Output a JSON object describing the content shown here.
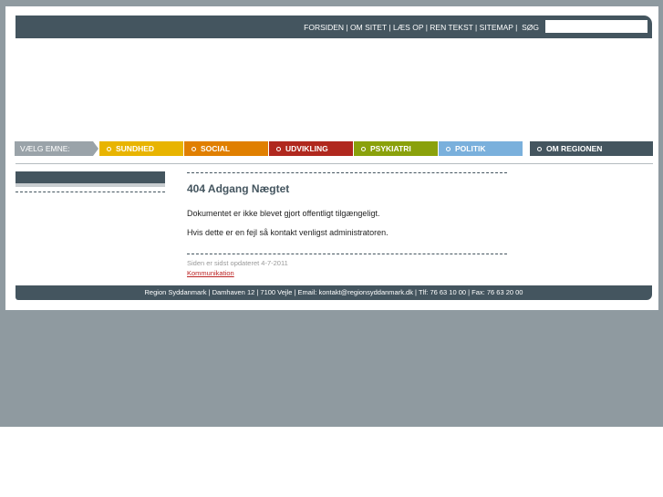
{
  "top_nav": {
    "links": [
      "FORSIDEN",
      "OM SITET",
      "LÆS OP",
      "REN TEKST",
      "SITEMAP"
    ],
    "search_label": "SØG",
    "search_value": ""
  },
  "topic_nav": {
    "label": "VÆLG EMNE:",
    "items": [
      {
        "label": "SUNDHED",
        "color": "#e8b400"
      },
      {
        "label": "SOCIAL",
        "color": "#e07f00"
      },
      {
        "label": "UDVIKLING",
        "color": "#b0281e"
      },
      {
        "label": "PSYKIATRI",
        "color": "#8aa10b"
      },
      {
        "label": "POLITIK",
        "color": "#7ab0dc"
      }
    ],
    "om": "OM REGIONEN"
  },
  "content": {
    "title": "404 Adgang Nægtet",
    "p1": "Dokumentet er ikke blevet gjort offentligt tilgængeligt.",
    "p2": "Hvis dette er en fejl så kontakt venligst administratoren.",
    "updated": "Siden er sidst opdateret 4-7-2011",
    "link": "Kommunikation"
  },
  "footer": "Region Syddanmark | Damhaven 12 | 7100 Vejle | Email: kontakt@regionsyddanmark.dk | Tlf: 76 63 10 00 | Fax: 76 63 20 00"
}
